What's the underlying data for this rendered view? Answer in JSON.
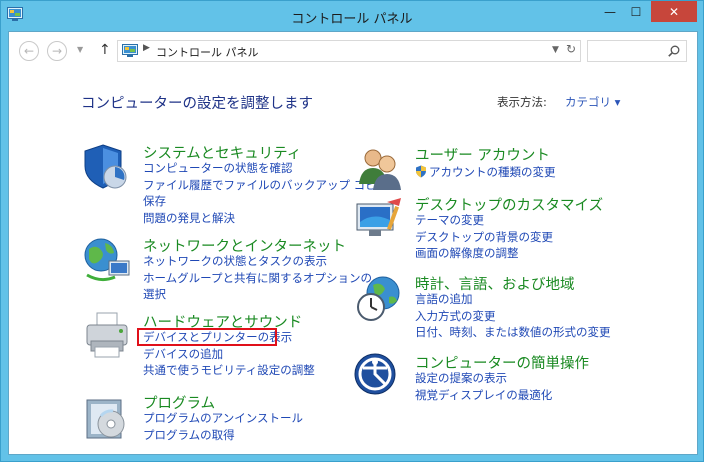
{
  "window": {
    "title": "コントロール パネル",
    "min_glyph": "—",
    "max_glyph": "☐",
    "close_glyph": "✕",
    "titlebar_color": "#62c2e8",
    "close_color": "#c7463b"
  },
  "address": {
    "back_glyph": "←",
    "forward_glyph": "→",
    "recent_glyph": "▼",
    "up_glyph": "↑",
    "separator_glyph": "▶",
    "crumb": "コントロール パネル",
    "dropdown_glyph": "▼",
    "refresh_glyph": "↻",
    "search_placeholder": ""
  },
  "header": {
    "heading": "コンピューターの設定を調整します",
    "view_by_label": "表示方法:",
    "view_by_value": "カテゴリ ▾"
  },
  "left_categories": [
    {
      "icon": "security-shield-icon",
      "title": "システムとセキュリティ",
      "links": [
        "コンピューターの状態を確認",
        "ファイル履歴でファイルのバックアップ コピーを",
        "保存",
        "問題の発見と解決"
      ]
    },
    {
      "icon": "network-globe-icon",
      "title": "ネットワークとインターネット",
      "links": [
        "ネットワークの状態とタスクの表示",
        "ホームグループと共有に関するオプションの",
        "選択"
      ]
    },
    {
      "icon": "printer-icon",
      "title": "ハードウェアとサウンド",
      "links": [
        "デバイスとプリンターの表示",
        "デバイスの追加",
        "共通で使うモビリティ設定の調整"
      ]
    },
    {
      "icon": "programs-disc-icon",
      "title": "プログラム",
      "links": [
        "プログラムのアンインストール",
        "プログラムの取得"
      ]
    }
  ],
  "right_categories": [
    {
      "icon": "users-icon",
      "title": "ユーザー アカウント",
      "links": [
        "アカウントの種類の変更"
      ]
    },
    {
      "icon": "desktop-brush-icon",
      "title": "デスクトップのカスタマイズ",
      "links": [
        "テーマの変更",
        "デスクトップの背景の変更",
        "画面の解像度の調整"
      ]
    },
    {
      "icon": "clock-globe-icon",
      "title": "時計、言語、および地域",
      "links": [
        "言語の追加",
        "入力方式の変更",
        "日付、時刻、または数値の形式の変更"
      ]
    },
    {
      "icon": "ease-of-access-icon",
      "title": "コンピューターの簡単操作",
      "links": [
        "設定の提案の表示",
        "視覚ディスプレイの最適化"
      ]
    }
  ],
  "colors": {
    "category_title": "#1a8a22",
    "link": "#1f48b5",
    "heading": "#1e3287",
    "highlight": "#e0101a"
  }
}
